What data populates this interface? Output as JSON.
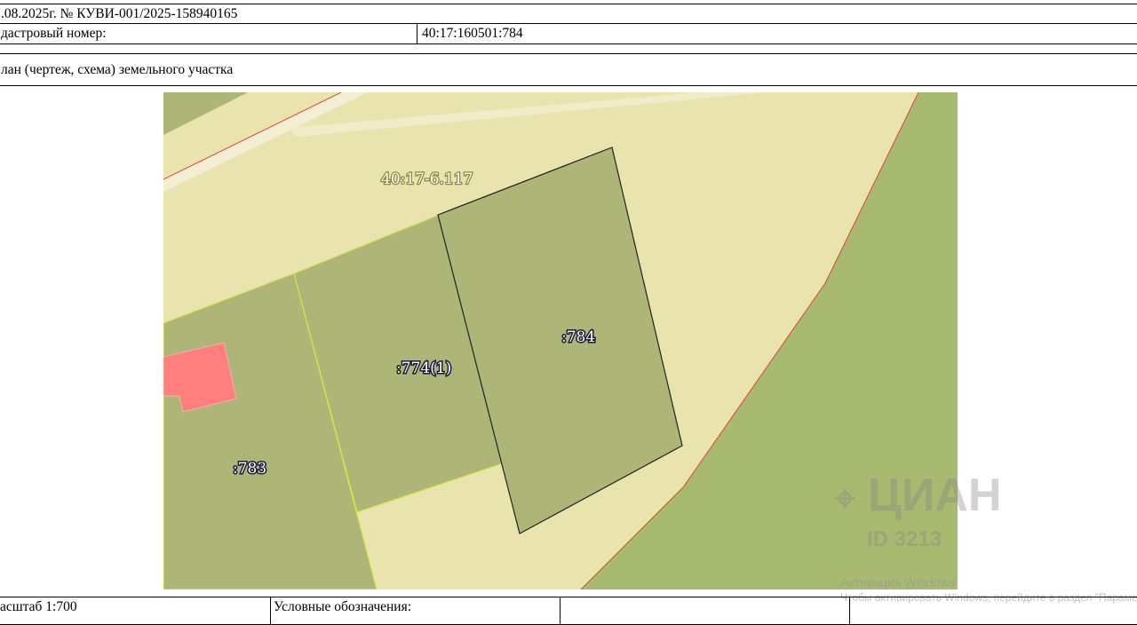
{
  "header": {
    "doc_line": ".08.2025г. № КУВИ-001/2025-158940165",
    "cadastral_label": "дастровый номер:",
    "cadastral_value": "40:17:160501:784",
    "plan_title": "лан (чертеж, схема) земельного участка"
  },
  "map": {
    "zone_label": "40:17-6.117",
    "parcels": [
      {
        "id": "p784",
        "label": ":784"
      },
      {
        "id": "p774",
        "label": ":774(1)"
      },
      {
        "id": "p783",
        "label": ":783"
      }
    ],
    "colors": {
      "zone_fill": "#e9e4ae",
      "parcel_fill": "#adb677",
      "green_area": "#a8ba6f",
      "building": "#ff7f7f",
      "boundary_red": "#e0443a",
      "boundary_yellow": "#d8e24a"
    }
  },
  "footer": {
    "scale_label": "асштаб 1:700",
    "legend_label": "Условные обозначения:"
  },
  "watermark": {
    "brand": "ЦИАН",
    "id_text": "ID 3213",
    "activation_title": "Активация Windows",
    "activation_sub": "Чтобы активировать Windows, перейдите в раздел \"Параметры\"."
  }
}
